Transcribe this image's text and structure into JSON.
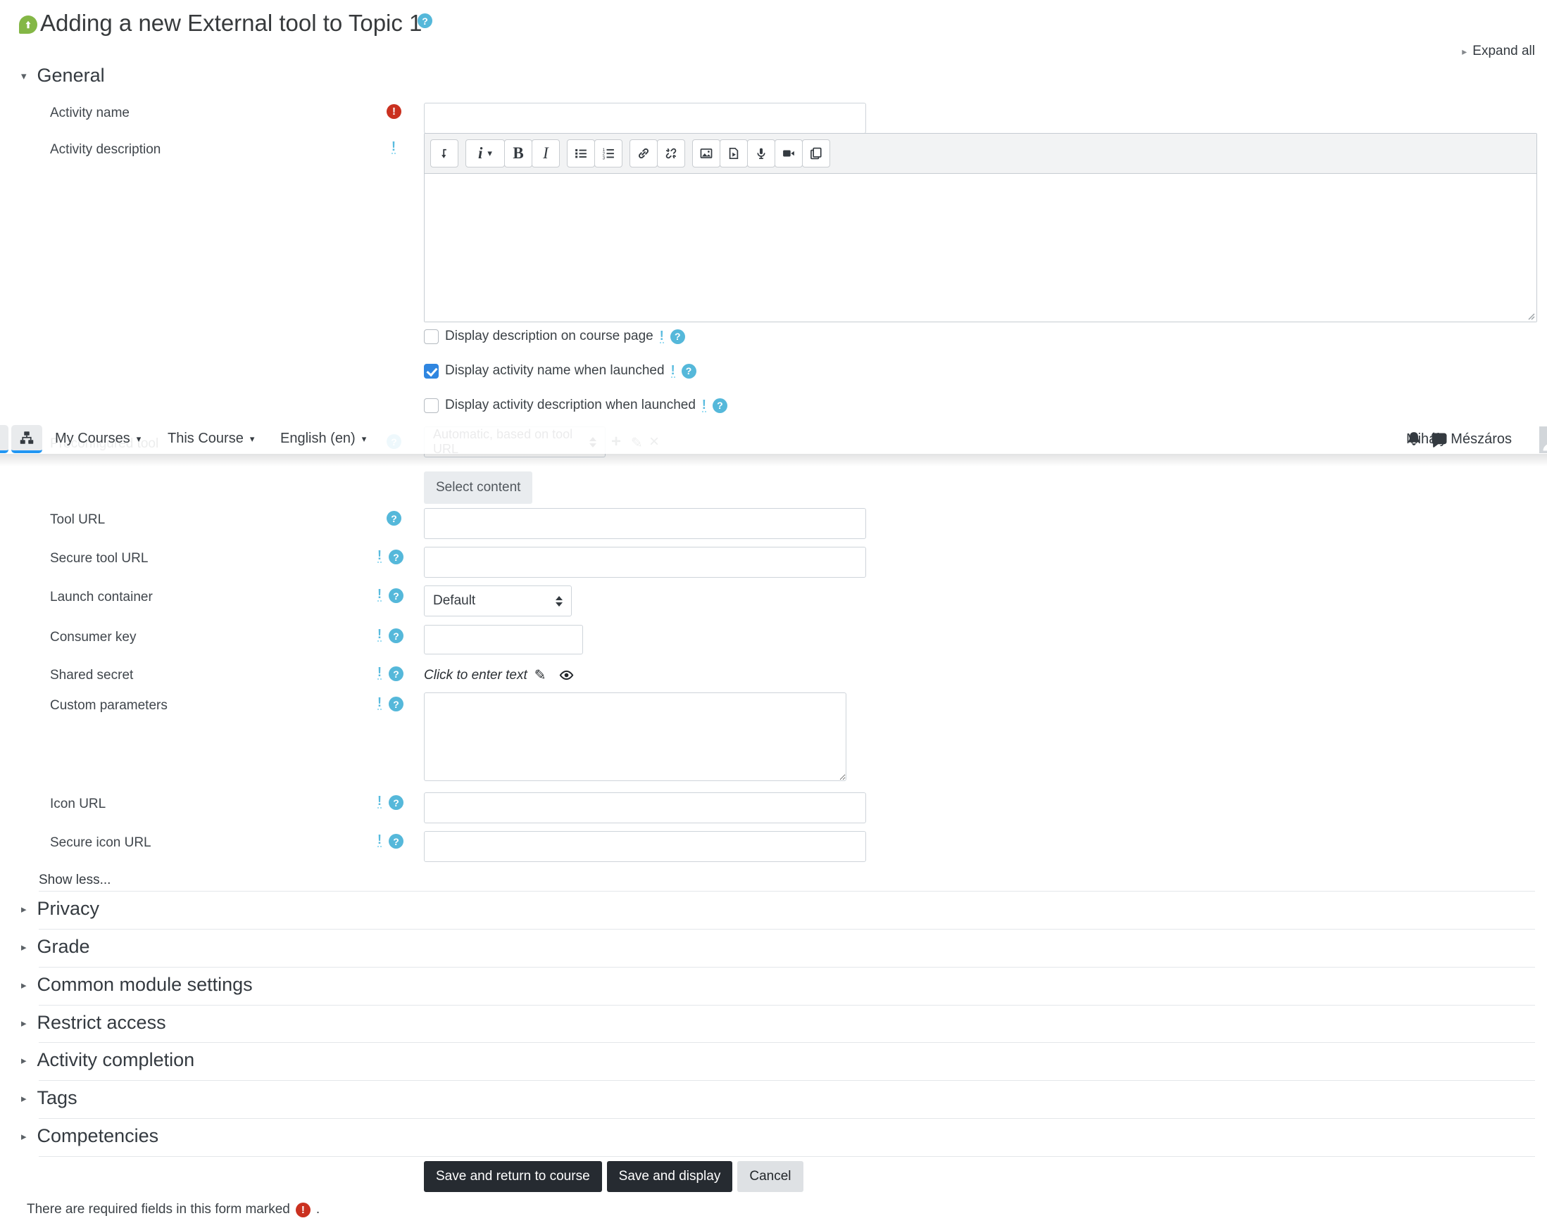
{
  "header": {
    "title": "Adding a new External tool to Topic 1",
    "expand_all": "Expand all"
  },
  "navbar": {
    "menus": [
      {
        "label": "My Courses"
      },
      {
        "label": "This Course"
      },
      {
        "label": "English (en)"
      }
    ],
    "user_name": "Mihály Mészáros",
    "icons": [
      "sitemap-icon",
      "bell-icon",
      "messages-icon",
      "avatar"
    ]
  },
  "general": {
    "heading": "General"
  },
  "editor": {
    "styles_glyph": "i",
    "bold_glyph": "B",
    "italic_glyph": "I",
    "toolbar_icons": [
      "collapse-toolbar-icon",
      "paragraph-styles-icon",
      "bold-icon",
      "italic-icon",
      "unordered-list-icon",
      "ordered-list-icon",
      "link-icon",
      "unlink-icon",
      "image-icon",
      "media-icon",
      "record-audio-icon",
      "record-video-icon",
      "manage-files-icon"
    ]
  },
  "fields": {
    "activity_name": {
      "label": "Activity name",
      "value": ""
    },
    "activity_description": {
      "label": "Activity description",
      "value": ""
    },
    "preconfigured_tool": {
      "label": "Preconfigured tool",
      "value": "Automatic, based on tool URL"
    },
    "select_content_button": "Select content",
    "tool_url": {
      "label": "Tool URL",
      "value": ""
    },
    "secure_tool_url": {
      "label": "Secure tool URL",
      "value": ""
    },
    "launch_container": {
      "label": "Launch container",
      "value": "Default"
    },
    "consumer_key": {
      "label": "Consumer key",
      "value": ""
    },
    "shared_secret": {
      "label": "Shared secret",
      "value": "Click to enter text"
    },
    "custom_parameters": {
      "label": "Custom parameters",
      "value": ""
    },
    "icon_url": {
      "label": "Icon URL",
      "value": ""
    },
    "secure_icon_url": {
      "label": "Secure icon URL",
      "value": ""
    }
  },
  "checkboxes": [
    {
      "label": "Display description on course page",
      "checked": false
    },
    {
      "label": "Display activity name when launched",
      "checked": true
    },
    {
      "label": "Display activity description when launched",
      "checked": false
    }
  ],
  "show_less": "Show less...",
  "sections": [
    "Privacy",
    "Grade",
    "Common module settings",
    "Restrict access",
    "Activity completion",
    "Tags",
    "Competencies"
  ],
  "actions": {
    "save_return": "Save and return to course",
    "save_display": "Save and display",
    "cancel": "Cancel"
  },
  "footer": {
    "required_note": "There are required fields in this form marked",
    "suffix": "."
  },
  "colors": {
    "module_green": "#84b746",
    "help_blue": "#55b8da",
    "advanced_blue": "#58bbdf",
    "required_red": "#ca3120",
    "checkbox_blue": "#2f86e0",
    "nav_underline_blue": "#2196f3",
    "dark_button": "#262b31",
    "light_button": "#dee1e4"
  }
}
